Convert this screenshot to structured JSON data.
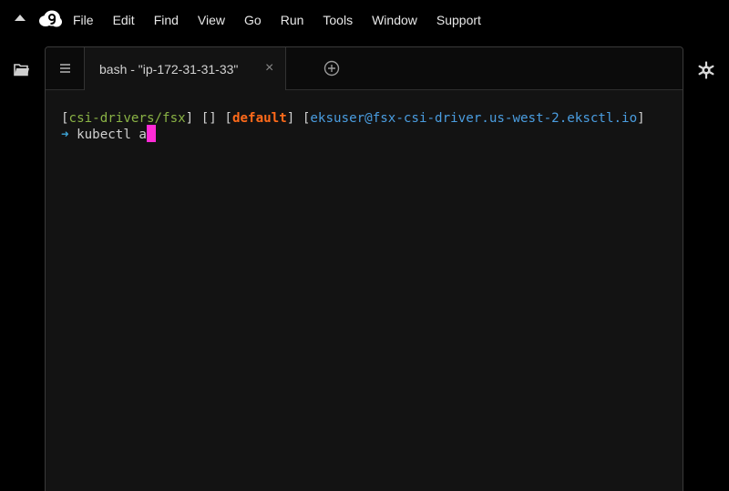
{
  "menubar": {
    "items": [
      "File",
      "Edit",
      "Find",
      "View",
      "Go",
      "Run",
      "Tools",
      "Window",
      "Support"
    ]
  },
  "tabs": [
    {
      "label": "bash - \"ip-172-31-31-33\"",
      "close": "×"
    }
  ],
  "terminal": {
    "bracket_open": "[",
    "bracket_close": "]",
    "space": " ",
    "dir": "csi-drivers/fsx",
    "empty_brackets": "[]",
    "profile": "default",
    "user_host": "eksuser@fsx-csi-driver.us-west-2.eksctl.io",
    "prompt_arrow": "➜",
    "command": "kubectl a"
  },
  "colors": {
    "background": "#000000",
    "panel": "#131313",
    "dir": "#8ab345",
    "profile": "#ff6a1a",
    "user_host": "#4a9de0",
    "cursor": "#ff2bd6"
  },
  "icons": {
    "collapse": "triangle-up-icon",
    "logo": "cloud9-logo-icon",
    "folder": "folder-icon",
    "settings": "gear-icon",
    "tab_menu": "hamburger-icon",
    "add_tab": "plus-circle-icon"
  }
}
